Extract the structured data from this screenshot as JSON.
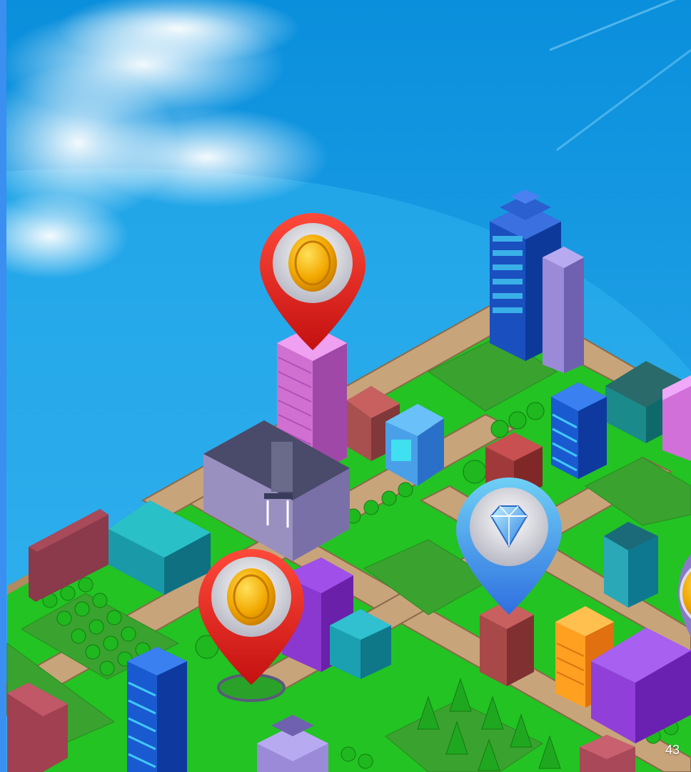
{
  "scene": {
    "page_number": "43",
    "colors": {
      "sky_top": "#0a8fdc",
      "sky_bottom": "#2aa8ea",
      "left_edge_stripe": "#3a8ff0",
      "grass": "#22c322",
      "road": "#c8a47a",
      "road_edge": "#8a6a4a",
      "park": "#3a9a2a",
      "pin_red": "#e02020",
      "pin_blue": "#3aa8e8",
      "coin": "#f2a800"
    },
    "pins": [
      {
        "icon": "coin-icon",
        "color": "red"
      },
      {
        "icon": "coin-icon",
        "color": "red"
      },
      {
        "icon": "diamond-icon",
        "color": "blue"
      },
      {
        "icon": "coin-icon",
        "color": "partial"
      }
    ]
  }
}
